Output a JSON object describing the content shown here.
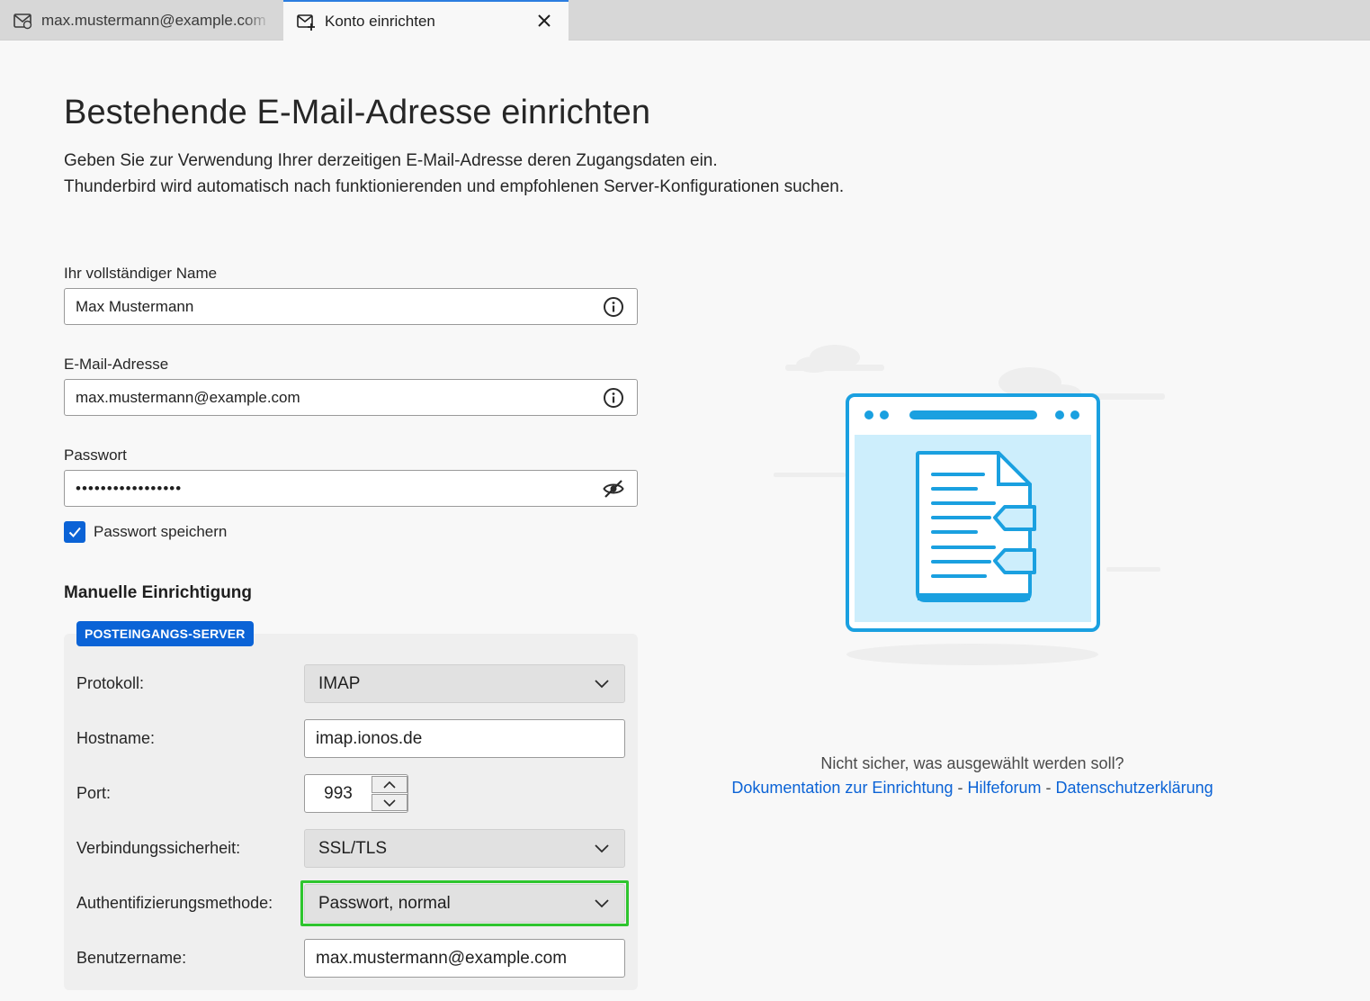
{
  "tabs": [
    {
      "label": "max.mustermann@example.com",
      "icon": "mail-account-icon"
    },
    {
      "label": "Konto einrichten",
      "icon": "mail-setup-icon",
      "active": true
    }
  ],
  "page": {
    "title": "Bestehende E-Mail-Adresse einrichten",
    "subtitle_line1": "Geben Sie zur Verwendung Ihrer derzeitigen E-Mail-Adresse deren Zugangsdaten ein.",
    "subtitle_line2": "Thunderbird wird automatisch nach funktionierenden und empfohlenen Server-Konfigurationen suchen."
  },
  "form": {
    "name_label": "Ihr vollständiger Name",
    "name_value": "Max Mustermann",
    "email_label": "E-Mail-Adresse",
    "email_value": "max.mustermann@example.com",
    "password_label": "Passwort",
    "password_value": "•••••••••••••••••",
    "remember_password_label": "Passwort speichern",
    "remember_password_checked": true
  },
  "manual": {
    "title": "Manuelle Einrichtigung",
    "badge": "POSTEINGANGS-SERVER",
    "protocol_label": "Protokoll:",
    "protocol_value": "IMAP",
    "hostname_label": "Hostname:",
    "hostname_value": "imap.ionos.de",
    "port_label": "Port:",
    "port_value": "993",
    "security_label": "Verbindungssicherheit:",
    "security_value": "SSL/TLS",
    "auth_label": "Authentifizierungsmethode:",
    "auth_value": "Passwort, normal",
    "username_label": "Benutzername:",
    "username_value": "max.mustermann@example.com"
  },
  "help": {
    "question": "Nicht sicher, was ausgewählt werden soll?",
    "link_docs": "Dokumentation zur Einrichtung",
    "separator": " - ",
    "link_forum": "Hilfeforum",
    "link_privacy": "Datenschutzerklärung"
  },
  "colors": {
    "accent": "#0b63d6",
    "highlight_border": "#2ec52e",
    "illustration_blue": "#1aa0e0",
    "illustration_fill": "#cdeefc"
  }
}
